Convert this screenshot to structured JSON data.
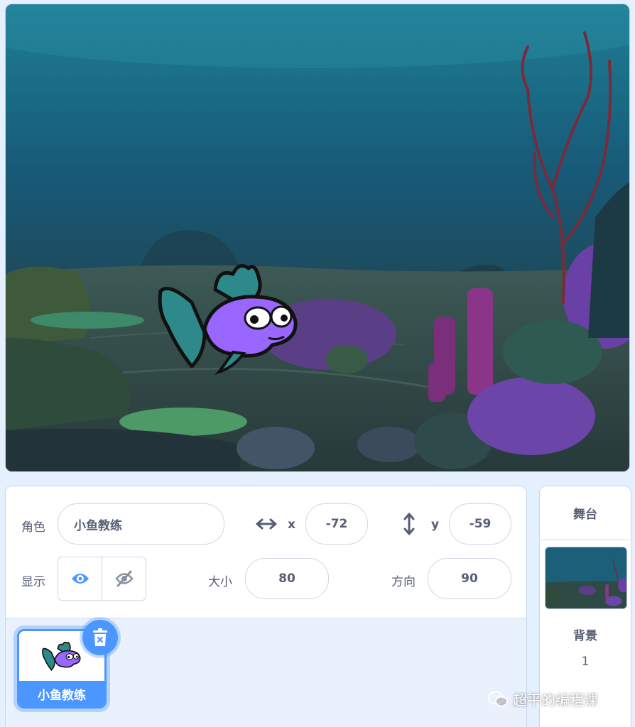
{
  "sprite_info": {
    "sprite_label": "角色",
    "sprite_name": "小鱼教练",
    "x_label": "x",
    "x_value": "-72",
    "y_label": "y",
    "y_value": "-59",
    "show_label": "显示",
    "size_label": "大小",
    "size_value": "80",
    "direction_label": "方向",
    "direction_value": "90"
  },
  "sprite_list": [
    {
      "name": "小鱼教练",
      "selected": true
    }
  ],
  "stage_panel": {
    "title": "舞台",
    "backdrop_label": "背景",
    "backdrop_count": "1"
  },
  "watermark": {
    "text": "超平的编程课"
  },
  "colors": {
    "accent": "#4c97ff",
    "text": "#575e75",
    "fish_body": "#9966ff",
    "fish_fin": "#2e8a8a"
  }
}
